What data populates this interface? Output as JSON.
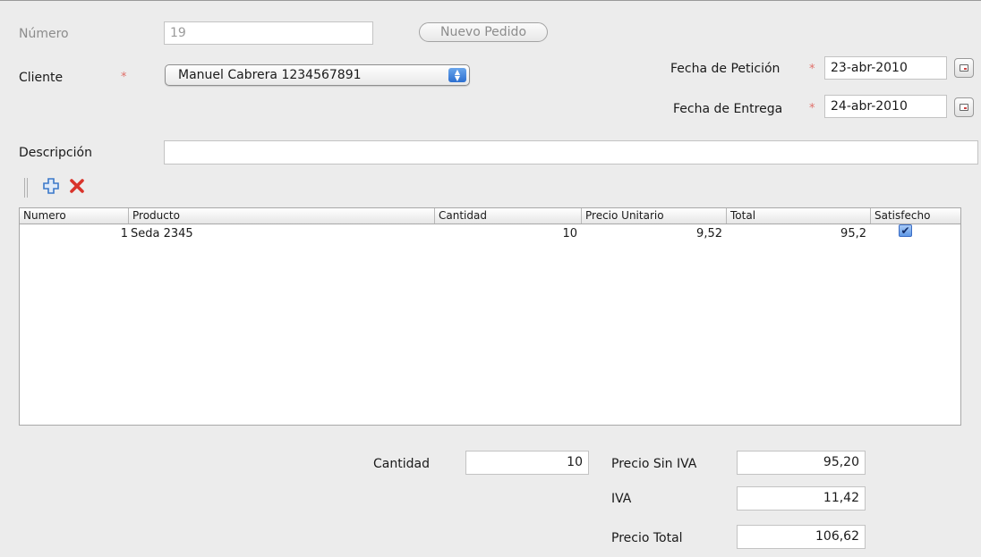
{
  "form": {
    "numero_label": "Número",
    "numero_value": "19",
    "nuevo_pedido_label": "Nuevo Pedido",
    "cliente_label": "Cliente",
    "cliente_value": "Manuel Cabrera 1234567891",
    "required_mark": "*",
    "fecha_peticion_label": "Fecha de Petición",
    "fecha_peticion_value": "23-abr-2010",
    "fecha_entrega_label": "Fecha de Entrega",
    "fecha_entrega_value": "24-abr-2010",
    "descripcion_label": "Descripción",
    "descripcion_value": ""
  },
  "toolbar": {
    "add_icon": "plus-icon",
    "delete_icon": "x-icon",
    "add_color": "#3b78c9",
    "delete_color": "#d9342b"
  },
  "table": {
    "columns": [
      "Numero",
      "Producto",
      "Cantidad",
      "Precio Unitario",
      "Total",
      "Satisfecho"
    ],
    "rows": [
      {
        "numero": "1",
        "producto": "Seda 2345",
        "cantidad": "10",
        "precio_unitario": "9,52",
        "total": "95,2",
        "satisfecho": true
      }
    ]
  },
  "totals": {
    "cantidad_label": "Cantidad",
    "cantidad_value": "10",
    "precio_sin_iva_label": "Precio Sin IVA",
    "precio_sin_iva_value": "95,20",
    "iva_label": "IVA",
    "iva_value": "11,42",
    "precio_total_label": "Precio Total",
    "precio_total_value": "106,62"
  }
}
